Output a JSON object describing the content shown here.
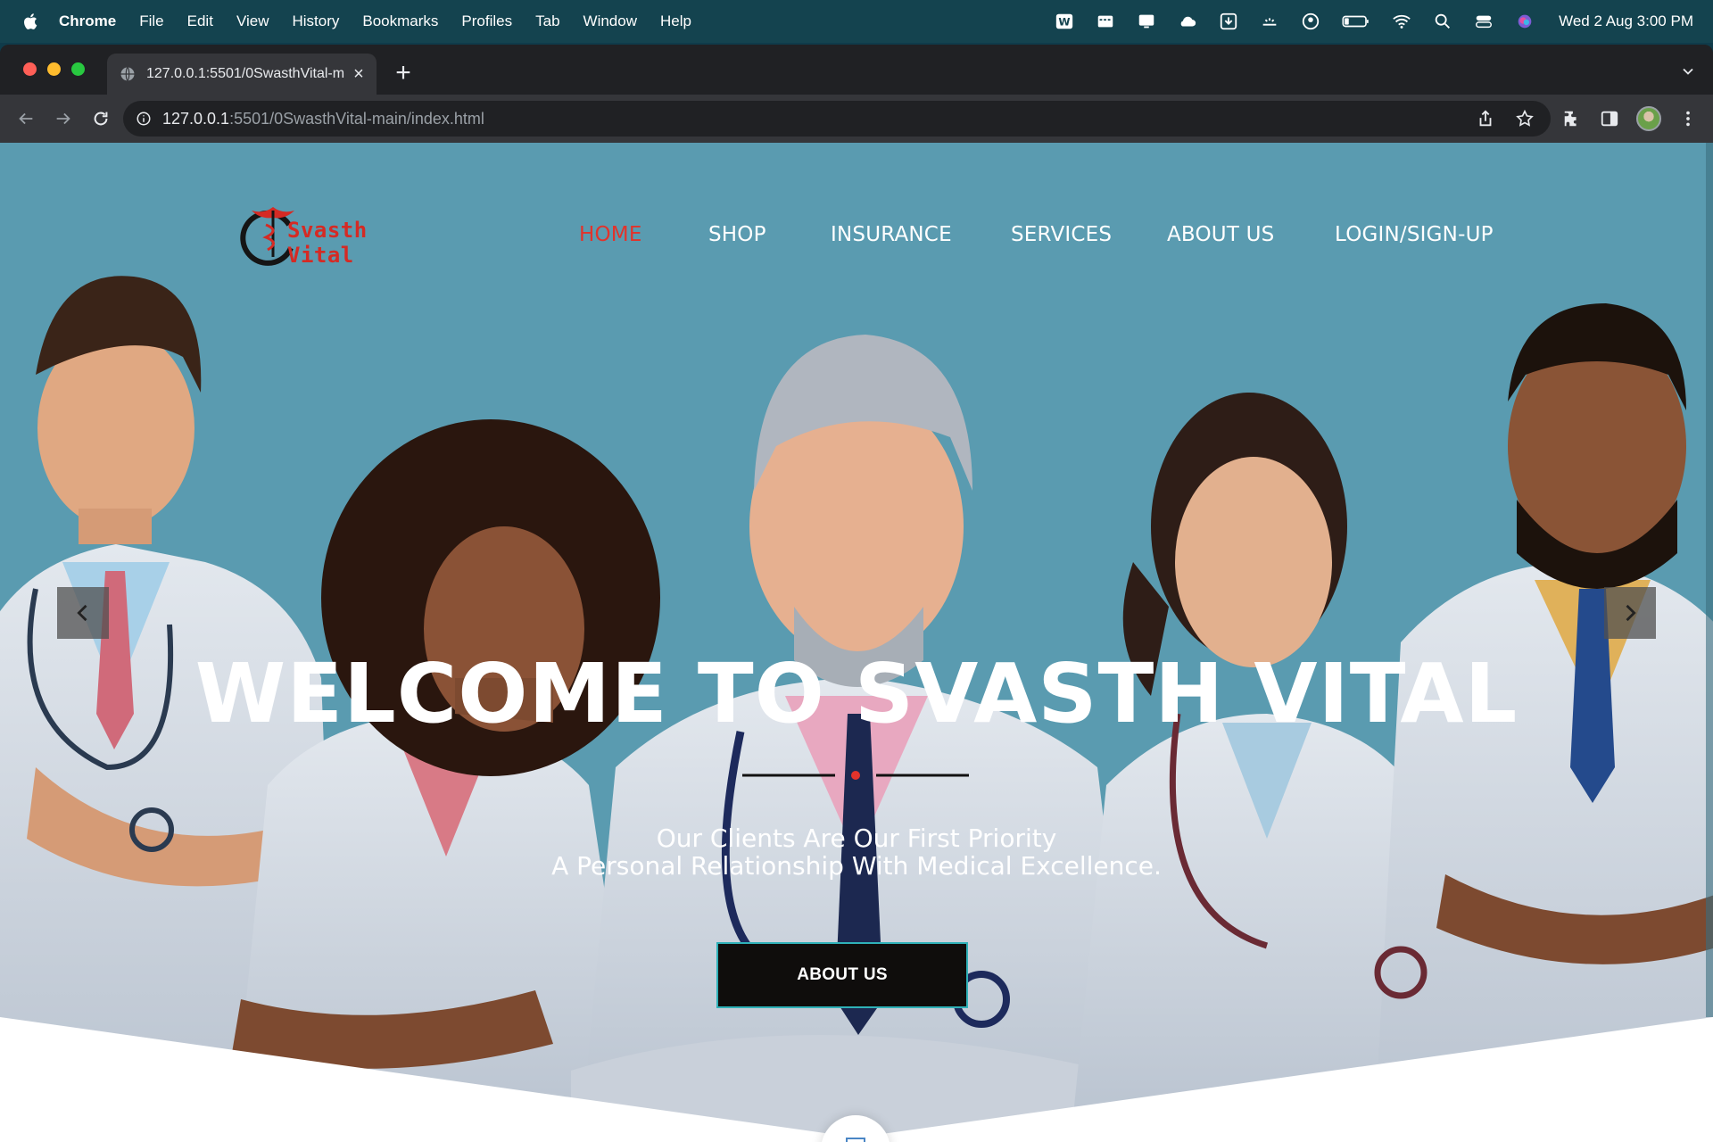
{
  "menubar": {
    "app": "Chrome",
    "items": [
      "File",
      "Edit",
      "View",
      "History",
      "Bookmarks",
      "Profiles",
      "Tab",
      "Window",
      "Help"
    ],
    "clock": "Wed 2 Aug  3:00 PM",
    "icons": [
      "word-icon",
      "screen-icon",
      "display-icon",
      "cloud-icon",
      "download-icon",
      "brightness-icon",
      "user-circle-icon",
      "battery-icon",
      "wifi-icon",
      "search-icon",
      "control-center-icon",
      "siri-icon"
    ]
  },
  "browser": {
    "tab_title": "127.0.0.1:5501/0SwasthVital-m",
    "tab_close": "×",
    "new_tab": "+",
    "url_host": "127.0.0.1",
    "url_path": ":5501/0SwasthVital-main/index.html"
  },
  "site": {
    "logo_text": "Svasth Vital",
    "nav": [
      "HOME",
      "SHOP",
      "INSURANCE",
      "SERVICES",
      "ABOUT US",
      "LOGIN/SIGN-UP"
    ],
    "active_nav": "HOME",
    "hero_title": "WELCOME TO SVASTH VITAL",
    "hero_line1": "Our Clients Are Our First Priority",
    "hero_line2": "A Personal Relationship With Medical Excellence.",
    "cta": "ABOUT US",
    "accent_color": "#e2332b",
    "hero_bg_color": "#5a9bb0"
  }
}
